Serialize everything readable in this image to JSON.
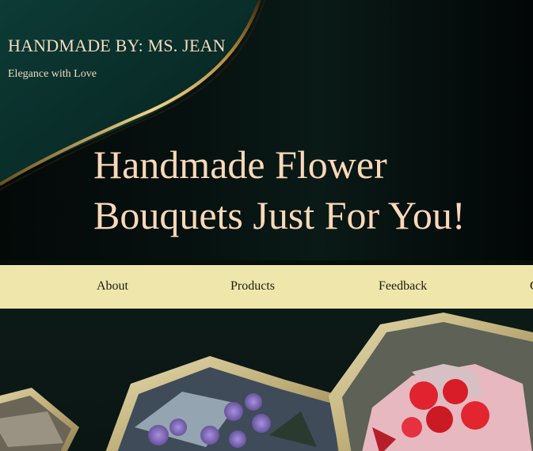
{
  "header": {
    "brand": "HANDMADE BY: MS. JEAN",
    "tagline": "Elegance with Love"
  },
  "hero": {
    "headline_line1": "Handmade Flower",
    "headline_line2": "Bouquets Just For You!"
  },
  "nav": {
    "items": [
      {
        "label": "About"
      },
      {
        "label": "Products"
      },
      {
        "label": "Feedback"
      },
      {
        "label": "C"
      }
    ]
  },
  "colors": {
    "nav_background": "#eee6ab",
    "headline_text": "#fbd9b8",
    "hero_background": "#06110f",
    "accent_gold": "#d9b25a",
    "accent_teal": "#0f3a35"
  },
  "gallery": {
    "images": [
      "purple-roses-bouquet",
      "red-roses-bouquet",
      "wrapped-bouquet"
    ]
  }
}
